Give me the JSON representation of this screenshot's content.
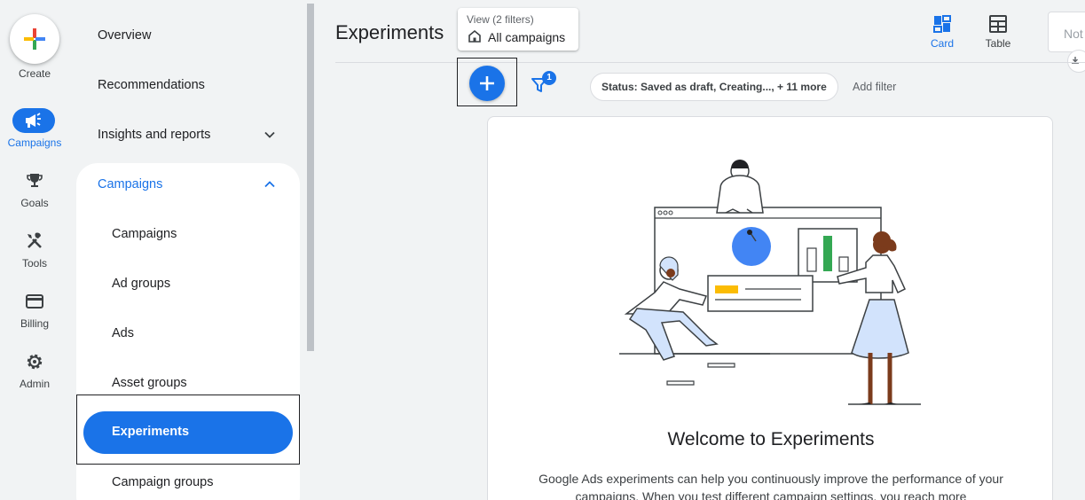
{
  "rail": {
    "create_label": "Create",
    "items": [
      {
        "label": "Campaigns",
        "icon": "megaphone-icon"
      },
      {
        "label": "Goals",
        "icon": "trophy-icon"
      },
      {
        "label": "Tools",
        "icon": "tools-icon"
      },
      {
        "label": "Billing",
        "icon": "credit-card-icon"
      },
      {
        "label": "Admin",
        "icon": "gear-icon"
      }
    ]
  },
  "nav": {
    "items": [
      "Overview",
      "Recommendations",
      "Insights and reports"
    ],
    "section": "Campaigns",
    "subitems": [
      "Campaigns",
      "Ad groups",
      "Ads",
      "Asset groups",
      "Experiments",
      "Campaign groups"
    ]
  },
  "header": {
    "title": "Experiments",
    "view_sub": "View (2 filters)",
    "view_main": "All campaigns",
    "card_label": "Card",
    "table_label": "Table",
    "not_label": "Not"
  },
  "toolbar": {
    "filter_count": "1",
    "status_chip": "Status: Saved as draft, Creating..., + 11 more",
    "add_filter": "Add filter"
  },
  "welcome": {
    "title": "Welcome to Experiments",
    "body": "Google Ads experiments can help you continuously improve the performance of your campaigns. When you test different campaign settings, you reach more"
  },
  "colors": {
    "accent": "#1a73e8",
    "background": "#f1f3f4",
    "illustration_blue": "#4285f4",
    "illustration_green": "#34a853",
    "illustration_yellow": "#fbbc04"
  }
}
